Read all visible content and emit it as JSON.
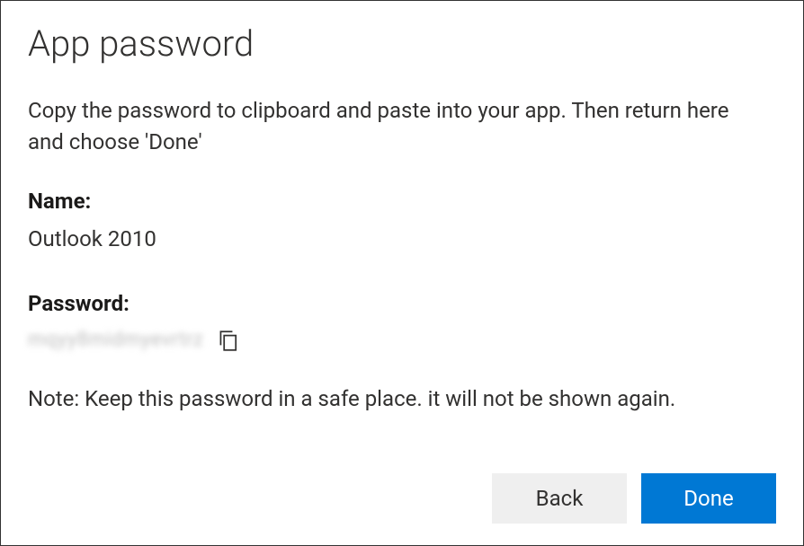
{
  "dialog": {
    "title": "App password",
    "instruction": "Copy the password to clipboard and paste into your app. Then return here and choose 'Done'",
    "name_label": "Name:",
    "name_value": "Outlook 2010",
    "password_label": "Password:",
    "password_value": "mqyy8midmyevrtrz",
    "note": "Note: Keep this password in a safe place. it will not be shown again.",
    "buttons": {
      "back": "Back",
      "done": "Done"
    }
  }
}
